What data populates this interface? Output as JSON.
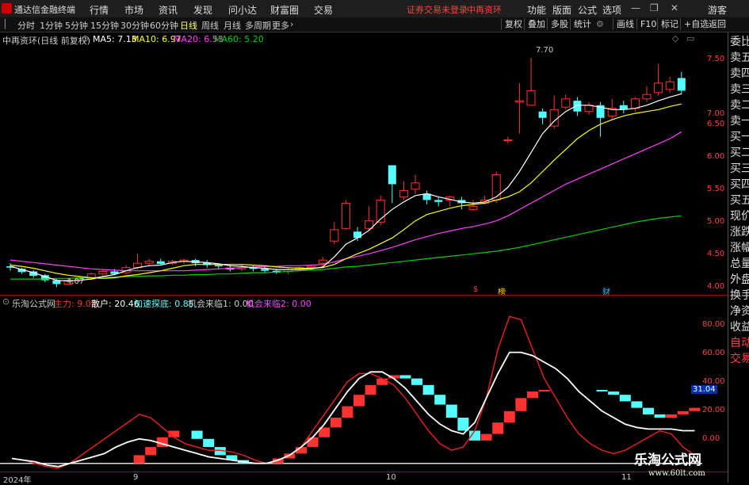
{
  "menubar": {
    "app_title": "通达信金融终端",
    "menus": [
      "行情",
      "市场",
      "资讯",
      "发现",
      "问小达",
      "财富圈",
      "交易"
    ],
    "warning": "证券交易未登录",
    "stock_name": "中再资环",
    "right_menus": [
      "功能",
      "版面",
      "公式",
      "选项"
    ],
    "guest": "游客"
  },
  "periodbar": {
    "periods": [
      "分时",
      "1分钟",
      "5分钟",
      "15分钟",
      "30分钟",
      "60分钟",
      "日线",
      "周线",
      "月线",
      "多周期",
      "更多"
    ],
    "active": "日线",
    "tools": [
      "复权",
      "叠加",
      "多股",
      "统计",
      "画线",
      "F10",
      "标记",
      "+自选",
      "返回"
    ]
  },
  "info": {
    "title": "中再资环(日线 前复权)",
    "ma5": "MA5: 7.13",
    "ma10": "MA10: 6.97",
    "ma20": "MA20: 6.53",
    "ma60": "MA60: 5.20"
  },
  "colors": {
    "up": "#ff3232",
    "down": "#54ffff",
    "ma5": "#ffffff",
    "ma10": "#ffff00",
    "ma20": "#ff40ff",
    "ma60": "#00d000",
    "axis": "#ff4040",
    "grid": "#aa0000"
  },
  "rightpanel": {
    "items": [
      "委比",
      "卖五",
      "卖四",
      "卖三",
      "卖二",
      "卖一",
      "买一",
      "买二",
      "买三",
      "买四",
      "买五",
      "现价",
      "涨跌",
      "涨幅",
      "总量",
      "外盘",
      "换手",
      "净资",
      "收益",
      "自动",
      "交易"
    ]
  },
  "price_axis": [
    "7.50",
    "7.00",
    "6.50",
    "6.00",
    "5.50",
    "5.00",
    "4.50",
    "4.00"
  ],
  "indicator": {
    "name": "乐淘公式网",
    "zhuli": "主力: 9.03",
    "sanhu": "散户: 20.46",
    "jiasu": "加速探底: 0.85",
    "jihui1": "机会来临1: 0.00",
    "jihui2": "机会来临2: 0.00",
    "axis": [
      "80.00",
      "60.00",
      "40.00",
      "20.00",
      "0.00"
    ],
    "current_badge": "31.04"
  },
  "time_axis": [
    "2024年",
    "9",
    "10",
    "11"
  ],
  "annotations": {
    "high": "7.70",
    "low": "4.07",
    "mark_s": "$",
    "mark_bang": "榜",
    "mark_cai": "财"
  },
  "watermark": {
    "site": "乐淘公式网",
    "url": "www.60lt.com"
  },
  "chart_data": {
    "type": "candlestick",
    "price_range": [
      3.95,
      7.9
    ],
    "candles": [
      [
        4.4,
        4.38,
        4.45,
        4.33
      ],
      [
        4.36,
        4.31,
        4.38,
        4.28
      ],
      [
        4.32,
        4.25,
        4.34,
        4.22
      ],
      [
        4.26,
        4.18,
        4.28,
        4.15
      ],
      [
        4.18,
        4.12,
        4.2,
        4.07
      ],
      [
        4.12,
        4.18,
        4.22,
        4.1
      ],
      [
        4.18,
        4.2,
        4.24,
        4.15
      ],
      [
        4.2,
        4.28,
        4.3,
        4.18
      ],
      [
        4.28,
        4.32,
        4.35,
        4.26
      ],
      [
        4.32,
        4.28,
        4.36,
        4.26
      ],
      [
        4.3,
        4.38,
        4.42,
        4.28
      ],
      [
        4.38,
        4.45,
        4.6,
        4.35
      ],
      [
        4.45,
        4.48,
        4.52,
        4.4
      ],
      [
        4.48,
        4.44,
        4.52,
        4.42
      ],
      [
        4.45,
        4.48,
        4.5,
        4.42
      ],
      [
        4.48,
        4.5,
        4.52,
        4.44
      ],
      [
        4.5,
        4.45,
        4.52,
        4.4
      ],
      [
        4.46,
        4.42,
        4.5,
        4.38
      ],
      [
        4.42,
        4.4,
        4.45,
        4.36
      ],
      [
        4.38,
        4.35,
        4.42,
        4.32
      ],
      [
        4.36,
        4.38,
        4.42,
        4.33
      ],
      [
        4.38,
        4.36,
        4.42,
        4.32
      ],
      [
        4.36,
        4.33,
        4.4,
        4.3
      ],
      [
        4.33,
        4.3,
        4.36,
        4.28
      ],
      [
        4.32,
        4.35,
        4.38,
        4.28
      ],
      [
        4.35,
        4.38,
        4.4,
        4.32
      ],
      [
        4.38,
        4.4,
        4.42,
        4.34
      ],
      [
        4.45,
        4.5,
        4.55,
        4.4
      ],
      [
        4.8,
        4.98,
        5.1,
        4.75
      ],
      [
        5.0,
        5.4,
        5.45,
        4.98
      ],
      [
        4.95,
        4.85,
        5.02,
        4.8
      ],
      [
        5.0,
        5.12,
        5.35,
        4.98
      ],
      [
        5.1,
        5.45,
        5.52,
        5.05
      ],
      [
        6.0,
        5.7,
        6.0,
        5.4
      ],
      [
        5.5,
        5.6,
        5.75,
        5.45
      ],
      [
        5.62,
        5.72,
        5.85,
        5.55
      ],
      [
        5.55,
        5.45,
        5.6,
        5.38
      ],
      [
        5.45,
        5.42,
        5.5,
        5.35
      ],
      [
        5.45,
        5.5,
        5.52,
        5.35
      ],
      [
        5.45,
        5.4,
        5.5,
        5.3
      ],
      [
        5.3,
        5.35,
        5.45,
        5.28
      ],
      [
        5.4,
        5.45,
        5.52,
        5.38
      ],
      [
        5.45,
        5.85,
        5.9,
        5.4
      ],
      [
        6.4,
        6.4,
        6.45,
        6.35
      ],
      [
        7.0,
        7.02,
        7.3,
        6.5
      ],
      [
        6.95,
        7.18,
        7.7,
        6.95
      ],
      [
        6.85,
        6.75,
        6.9,
        6.65
      ],
      [
        6.62,
        6.88,
        7.1,
        6.58
      ],
      [
        6.92,
        7.05,
        7.12,
        6.88
      ],
      [
        7.02,
        6.85,
        7.08,
        6.78
      ],
      [
        6.85,
        6.95,
        7.0,
        6.8
      ],
      [
        6.95,
        6.75,
        7.0,
        6.45
      ],
      [
        6.78,
        6.9,
        7.05,
        6.72
      ],
      [
        6.95,
        6.88,
        7.02,
        6.82
      ],
      [
        6.9,
        7.05,
        7.08,
        6.85
      ],
      [
        7.05,
        7.12,
        7.25,
        7.0
      ],
      [
        7.15,
        7.3,
        7.6,
        7.1
      ],
      [
        7.2,
        7.32,
        7.4,
        7.15
      ],
      [
        7.38,
        7.18,
        7.48,
        7.12
      ]
    ],
    "ma5": [
      4.4,
      4.35,
      4.3,
      4.24,
      4.18,
      4.17,
      4.18,
      4.2,
      4.24,
      4.27,
      4.33,
      4.38,
      4.41,
      4.42,
      4.46,
      4.48,
      4.47,
      4.46,
      4.44,
      4.41,
      4.4,
      4.38,
      4.37,
      4.35,
      4.35,
      4.35,
      4.36,
      4.39,
      4.55,
      4.75,
      4.85,
      4.97,
      5.15,
      5.3,
      5.42,
      5.52,
      5.55,
      5.5,
      5.46,
      5.42,
      5.4,
      5.42,
      5.5,
      5.65,
      5.9,
      6.2,
      6.5,
      6.7,
      6.85,
      6.95,
      6.95,
      6.92,
      6.88,
      6.88,
      6.9,
      6.95,
      7.02,
      7.08,
      7.13
    ],
    "ma10": [
      4.42,
      4.4,
      4.37,
      4.33,
      4.29,
      4.26,
      4.24,
      4.22,
      4.21,
      4.22,
      4.25,
      4.27,
      4.3,
      4.33,
      4.37,
      4.41,
      4.43,
      4.43,
      4.43,
      4.43,
      4.43,
      4.42,
      4.41,
      4.39,
      4.38,
      4.37,
      4.37,
      4.38,
      4.43,
      4.52,
      4.6,
      4.67,
      4.76,
      4.85,
      4.98,
      5.12,
      5.22,
      5.27,
      5.32,
      5.36,
      5.38,
      5.4,
      5.45,
      5.5,
      5.58,
      5.72,
      5.9,
      6.08,
      6.25,
      6.42,
      6.55,
      6.65,
      6.72,
      6.78,
      6.82,
      6.85,
      6.88,
      6.93,
      6.97
    ],
    "ma20": [
      4.5,
      4.48,
      4.46,
      4.44,
      4.42,
      4.4,
      4.38,
      4.36,
      4.35,
      4.34,
      4.33,
      4.33,
      4.33,
      4.33,
      4.33,
      4.33,
      4.34,
      4.35,
      4.36,
      4.37,
      4.38,
      4.39,
      4.4,
      4.4,
      4.41,
      4.41,
      4.42,
      4.43,
      4.47,
      4.52,
      4.56,
      4.6,
      4.65,
      4.7,
      4.76,
      4.82,
      4.87,
      4.92,
      4.96,
      5.0,
      5.03,
      5.07,
      5.12,
      5.2,
      5.3,
      5.4,
      5.5,
      5.6,
      5.7,
      5.78,
      5.86,
      5.94,
      6.02,
      6.1,
      6.18,
      6.26,
      6.34,
      6.42,
      6.53
    ],
    "ma60": [
      4.2,
      4.2,
      4.2,
      4.2,
      4.21,
      4.21,
      4.22,
      4.22,
      4.23,
      4.23,
      4.24,
      4.24,
      4.25,
      4.25,
      4.26,
      4.26,
      4.27,
      4.27,
      4.28,
      4.28,
      4.29,
      4.3,
      4.3,
      4.31,
      4.32,
      4.33,
      4.34,
      4.35,
      4.37,
      4.39,
      4.4,
      4.42,
      4.44,
      4.46,
      4.48,
      4.5,
      4.52,
      4.54,
      4.56,
      4.58,
      4.6,
      4.62,
      4.64,
      4.67,
      4.7,
      4.74,
      4.78,
      4.82,
      4.86,
      4.9,
      4.94,
      4.98,
      5.02,
      5.06,
      5.1,
      5.13,
      5.16,
      5.18,
      5.2
    ],
    "indicator_range": [
      -5,
      95
    ],
    "zhuli": [
      0,
      0,
      0,
      0,
      0,
      0,
      0,
      0,
      0,
      0,
      0,
      5,
      10,
      16,
      20,
      20,
      15,
      10,
      5,
      2,
      0,
      0,
      0,
      3,
      6,
      10,
      16,
      22,
      28,
      35,
      42,
      48,
      52,
      54,
      52,
      48,
      42,
      36,
      28,
      20,
      14,
      18,
      25,
      32,
      40,
      44,
      45,
      45,
      45,
      45,
      45,
      44,
      42,
      38,
      34,
      30,
      28,
      30,
      32,
      34
    ],
    "sanhu": [
      3,
      2,
      0,
      -2,
      -3,
      0,
      5,
      10,
      15,
      20,
      25,
      30,
      28,
      22,
      16,
      12,
      10,
      8,
      8,
      7,
      5,
      2,
      0,
      2,
      5,
      10,
      20,
      30,
      40,
      50,
      55,
      55,
      52,
      48,
      40,
      30,
      20,
      12,
      8,
      10,
      20,
      40,
      70,
      90,
      88,
      70,
      52,
      40,
      28,
      18,
      12,
      8,
      6,
      8,
      12,
      16,
      20,
      18,
      10,
      5
    ],
    "white": [
      3,
      2,
      1,
      -1,
      -2,
      0,
      2,
      4,
      6,
      10,
      13,
      15,
      14,
      12,
      10,
      8,
      6,
      4,
      3,
      2,
      1,
      0,
      0,
      2,
      5,
      10,
      16,
      24,
      34,
      44,
      52,
      56,
      56,
      52,
      46,
      38,
      30,
      24,
      20,
      18,
      25,
      40,
      55,
      68,
      68,
      66,
      62,
      58,
      52,
      44,
      38,
      32,
      28,
      24,
      22,
      21,
      21,
      21,
      20,
      20
    ]
  }
}
